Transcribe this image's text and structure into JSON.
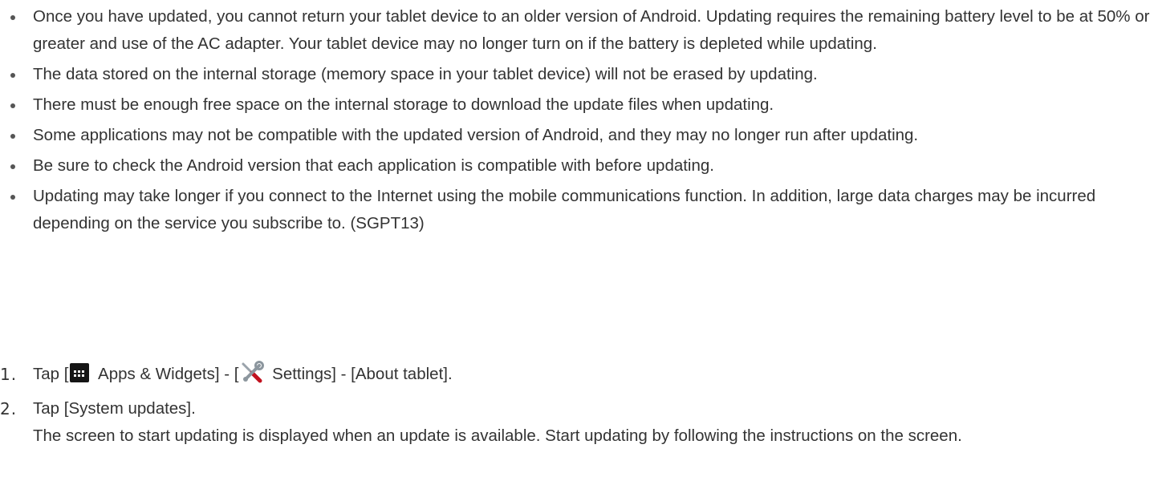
{
  "notes": [
    "Once you have updated, you cannot return your tablet device to an older version of Android. Updating requires the remaining battery level to be at 50% or greater and use of the AC adapter. Your tablet device may no longer turn on if the battery is depleted while updating.",
    "The data stored on the internal storage (memory space in your tablet device) will not be erased by updating.",
    "There must be enough free space on the internal storage to download the update files when updating.",
    "Some applications may not be compatible with the updated version of Android, and they may no longer run after updating.",
    "Be sure to check the Android version that each application is compatible with before updating.",
    "Updating may take longer if you connect to the Internet using the mobile communications function. In addition, large data charges may be incurred depending on the service you subscribe to. (SGPT13)"
  ],
  "steps": [
    {
      "number": "1.",
      "segments": {
        "open1": "Tap [",
        "apps_label": " Apps & Widgets] - [",
        "settings_label": " Settings] - [About tablet]."
      }
    },
    {
      "number": "2.",
      "text": "Tap [System updates].",
      "detail": "The screen to start updating is displayed when an update is available. Start updating by following the instructions on the screen."
    }
  ],
  "icons": {
    "apps": "apps-widgets-icon",
    "settings": "settings-tools-icon"
  },
  "colors": {
    "text": "#333333",
    "apps_icon_bg": "#151515"
  }
}
